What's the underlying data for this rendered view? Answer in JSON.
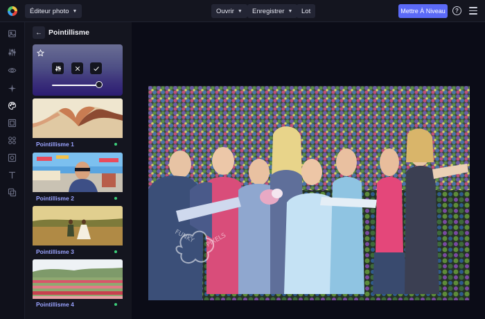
{
  "topbar": {
    "editor_label": "Éditeur photo",
    "open_label": "Ouvrir",
    "save_label": "Enregistrer",
    "batch_label": "Lot",
    "upgrade_label": "Mettre À Niveau",
    "help_icon": "question-circle-icon",
    "menu_icon": "hamburger-menu-icon"
  },
  "rail": {
    "icons": [
      "image-icon",
      "sliders-icon",
      "eye-icon",
      "sparkle-icon",
      "palette-icon",
      "frame-icon",
      "elements-icon",
      "texture-icon",
      "text-icon",
      "overlay-icon"
    ],
    "active": "palette-icon"
  },
  "panel": {
    "title": "Pointillisme",
    "active_card": {
      "buttons": [
        "adjust-icon",
        "close-icon",
        "check-icon"
      ],
      "intensity": 1.0
    },
    "presets": [
      {
        "label": "Pointillisme 1"
      },
      {
        "label": "Pointillisme 2"
      },
      {
        "label": "Pointillisme 3"
      },
      {
        "label": "Pointillisme 4"
      }
    ]
  },
  "colors": {
    "accent": "#5b6af7",
    "label": "#9aa3ff",
    "status_dot": "#3ccf7a",
    "background": "#0b0c17"
  }
}
